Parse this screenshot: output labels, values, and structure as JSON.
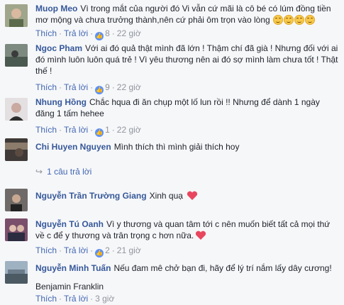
{
  "actions": {
    "like": "Thích",
    "reply": "Trả lời",
    "sep": "·"
  },
  "comments": [
    {
      "name": "Muop Meo",
      "text": "Vì trong mắt của người đó Vi vẫn cứ mãi là cô bé có lúm đồng tiền mơ mộng và chưa trưởng thành,nên cứ phải ôm trọn vào lòng",
      "likes": "8",
      "time": "22 giờ",
      "emoji_count": 4,
      "avatar_color": "#8a8f7d"
    },
    {
      "name": "Ngoc Pham",
      "text": "Với ai đó quả thật mình đã lớn ! Thậm chí đã già ! Nhưng đối với ai đó mình luôn luôn quá trẻ ! Vì yêu thương nên ai đó sợ mình làm chưa tốt ! Thật thế !",
      "likes": "9",
      "time": "22 giờ",
      "avatar_color": "#5e6b61"
    },
    {
      "name": "Nhung Hồng",
      "text": "Chắc hqua đi ăn chụp một lố lun rồi !! Nhưng để dành 1 ngày đăng 1 tấm hehee",
      "likes": "1",
      "time": "22 giờ",
      "avatar_color": "#d7d2d4"
    },
    {
      "name": "Chi Huyen Nguyen",
      "text": "Mình thích thì mình giải thích hoy",
      "reply_count_label": "1 câu trả lời",
      "avatar_color": "#3f3a37"
    },
    {
      "name": "Nguyễn Trần Trường Giang",
      "text": "Xinh quạ",
      "avatar_color": "#6f6a68"
    },
    {
      "name": "Nguyễn Tú Oanh",
      "text": "Vì y thương và quan tâm tới c nên muốn biết tất cả mọi thứ về c để y thương và trân trọng c hơn nữa.",
      "likes": "2",
      "time": "21 giờ",
      "avatar_color": "#7a4f6b"
    },
    {
      "name": "Nguyễn Minh Tuấn",
      "text": "Nếu đam mê chở bạn đi, hãy để lý trí nắm lấy dây cương!",
      "text2": "Benjamin Franklin",
      "time": "3 giờ",
      "avatar_color": "#6c7c8a"
    }
  ],
  "colors": {
    "link": "#365899",
    "action": "#4267b2",
    "meta": "#90949c",
    "like": "#5890ff",
    "heart": "#e8475f"
  }
}
